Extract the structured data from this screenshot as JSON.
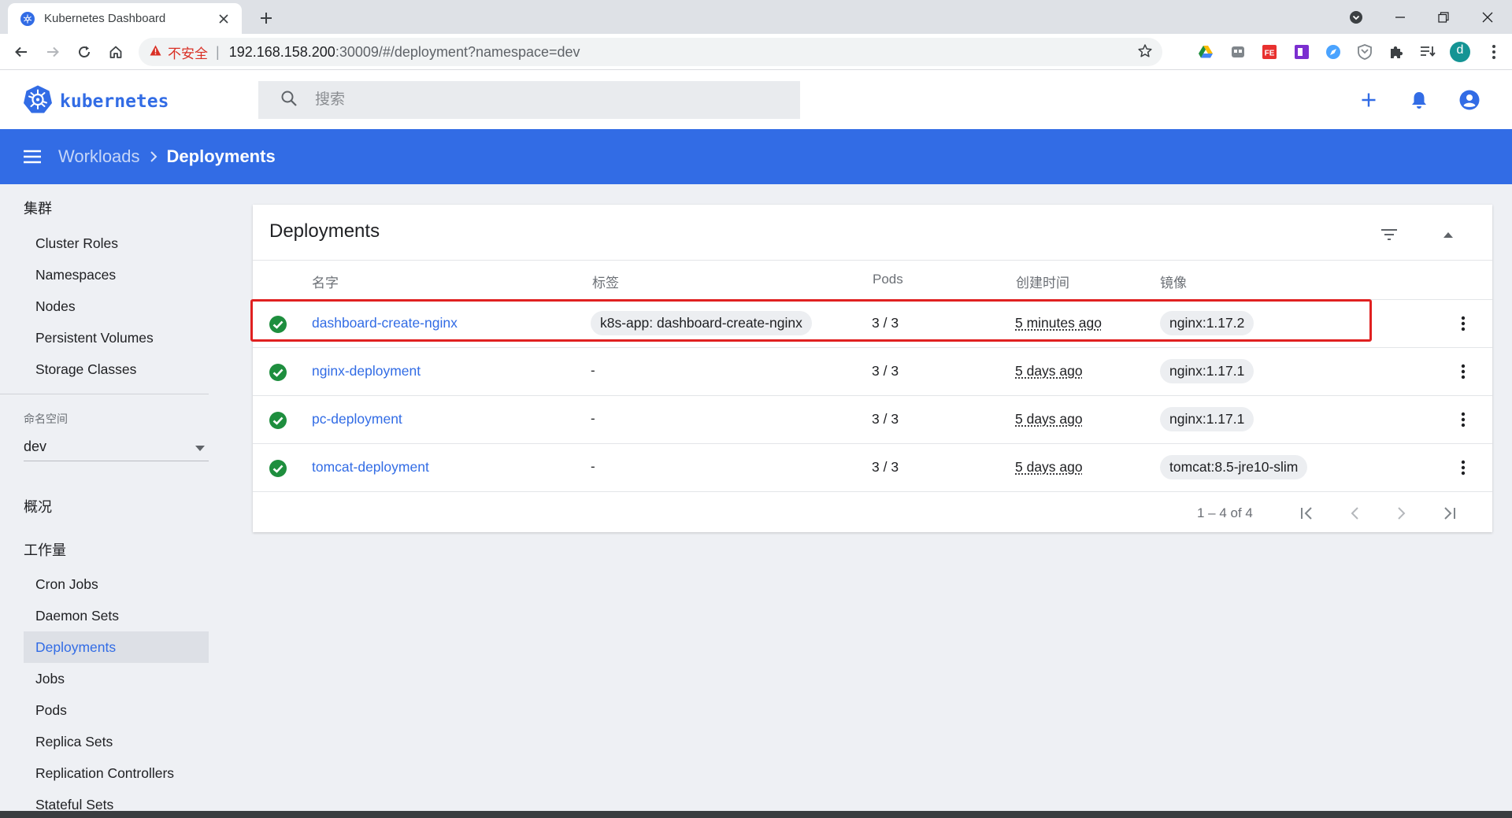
{
  "browser": {
    "tab_title": "Kubernetes Dashboard",
    "security_warning": "不安全",
    "url_host": "192.168.158.200",
    "url_rest": ":30009/#/deployment?namespace=dev",
    "profile_initial": "d"
  },
  "app": {
    "brand": "kubernetes",
    "search_placeholder": "搜索"
  },
  "breadcrumb": {
    "parent": "Workloads",
    "current": "Deployments"
  },
  "sidebar": {
    "cluster_heading": "集群",
    "cluster_items": [
      "Cluster Roles",
      "Namespaces",
      "Nodes",
      "Persistent Volumes",
      "Storage Classes"
    ],
    "namespace_label": "命名空间",
    "namespace_value": "dev",
    "overview": "概况",
    "workloads_heading": "工作量",
    "workload_items": [
      "Cron Jobs",
      "Daemon Sets",
      "Deployments",
      "Jobs",
      "Pods",
      "Replica Sets",
      "Replication Controllers",
      "Stateful Sets"
    ],
    "active_item": "Deployments"
  },
  "card": {
    "title": "Deployments",
    "columns": {
      "name": "名字",
      "labels": "标签",
      "pods": "Pods",
      "created": "创建时间",
      "images": "镜像"
    },
    "rows": [
      {
        "name": "dashboard-create-nginx",
        "labels": "k8s-app: dashboard-create-nginx",
        "pods": "3 / 3",
        "created": "5 minutes ago",
        "image": "nginx:1.17.2",
        "status": "running"
      },
      {
        "name": "nginx-deployment",
        "labels": "-",
        "pods": "3 / 3",
        "created": "5 days ago",
        "image": "nginx:1.17.1",
        "status": "running"
      },
      {
        "name": "pc-deployment",
        "labels": "-",
        "pods": "3 / 3",
        "created": "5 days ago",
        "image": "nginx:1.17.1",
        "status": "running"
      },
      {
        "name": "tomcat-deployment",
        "labels": "-",
        "pods": "3 / 3",
        "created": "5 days ago",
        "image": "tomcat:8.5-jre10-slim",
        "status": "running"
      }
    ],
    "pagination": "1 – 4 of 4"
  },
  "colors": {
    "accent": "#326ce5",
    "success": "#1e8e3e",
    "highlight": "#e02020"
  }
}
